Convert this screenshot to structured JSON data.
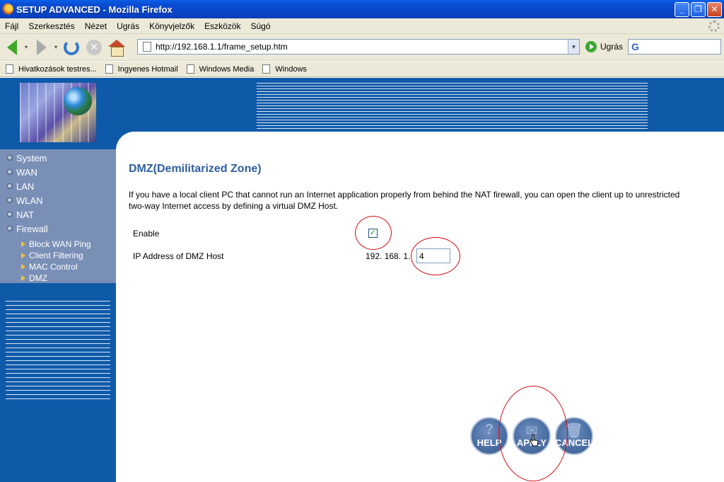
{
  "window": {
    "title": "SETUP ADVANCED - Mozilla Firefox",
    "minimize_glyph": "_",
    "restore_glyph": "❐",
    "close_glyph": "✕"
  },
  "menu": [
    "Fájl",
    "Szerkesztés",
    "Nézet",
    "Ugrás",
    "Könyvjelzők",
    "Eszközök",
    "Súgó"
  ],
  "nav": {
    "url": "http://192.168.1.1/frame_setup.htm",
    "go_label": "Ugrás",
    "search_placeholder": "",
    "search_engine_glyph": "G",
    "stop_glyph": "✕",
    "caret_glyph": "▾"
  },
  "bookmarks": [
    "Hivatkozások testres...",
    "Ingyenes Hotmail",
    "Windows Media",
    "Windows"
  ],
  "sidebar": {
    "items": [
      "System",
      "WAN",
      "LAN",
      "WLAN",
      "NAT",
      "Firewall"
    ],
    "sub_items": [
      "Block WAN Ping",
      "Client Filtering",
      "MAC Control",
      "DMZ"
    ]
  },
  "dmz": {
    "title": "DMZ(Demilitarized Zone)",
    "description": "If you have a local client PC that cannot run an Internet application properly from behind the NAT firewall, you can open the client up to unrestricted two-way Internet access by defining a virtual DMZ Host.",
    "enable_label": "Enable",
    "enable_checked": true,
    "check_glyph": "✓",
    "ip_label": "IP Address of DMZ Host",
    "ip_prefix": "192. 168. 1.",
    "ip_last_octet": "4"
  },
  "buttons": {
    "help": "HELP",
    "apply": "APPLY",
    "cancel": "CANCEL",
    "help_glyph": "?",
    "apply_glyph": "✉",
    "cancel_glyph": "🗑"
  },
  "colors": {
    "router_blue": "#0f5aa8",
    "sidebar_gray": "#7a8fb6",
    "title_blue": "#2e5f9f",
    "annotation_red": "#d01010",
    "xp_titlebar": "#0a50d8"
  }
}
